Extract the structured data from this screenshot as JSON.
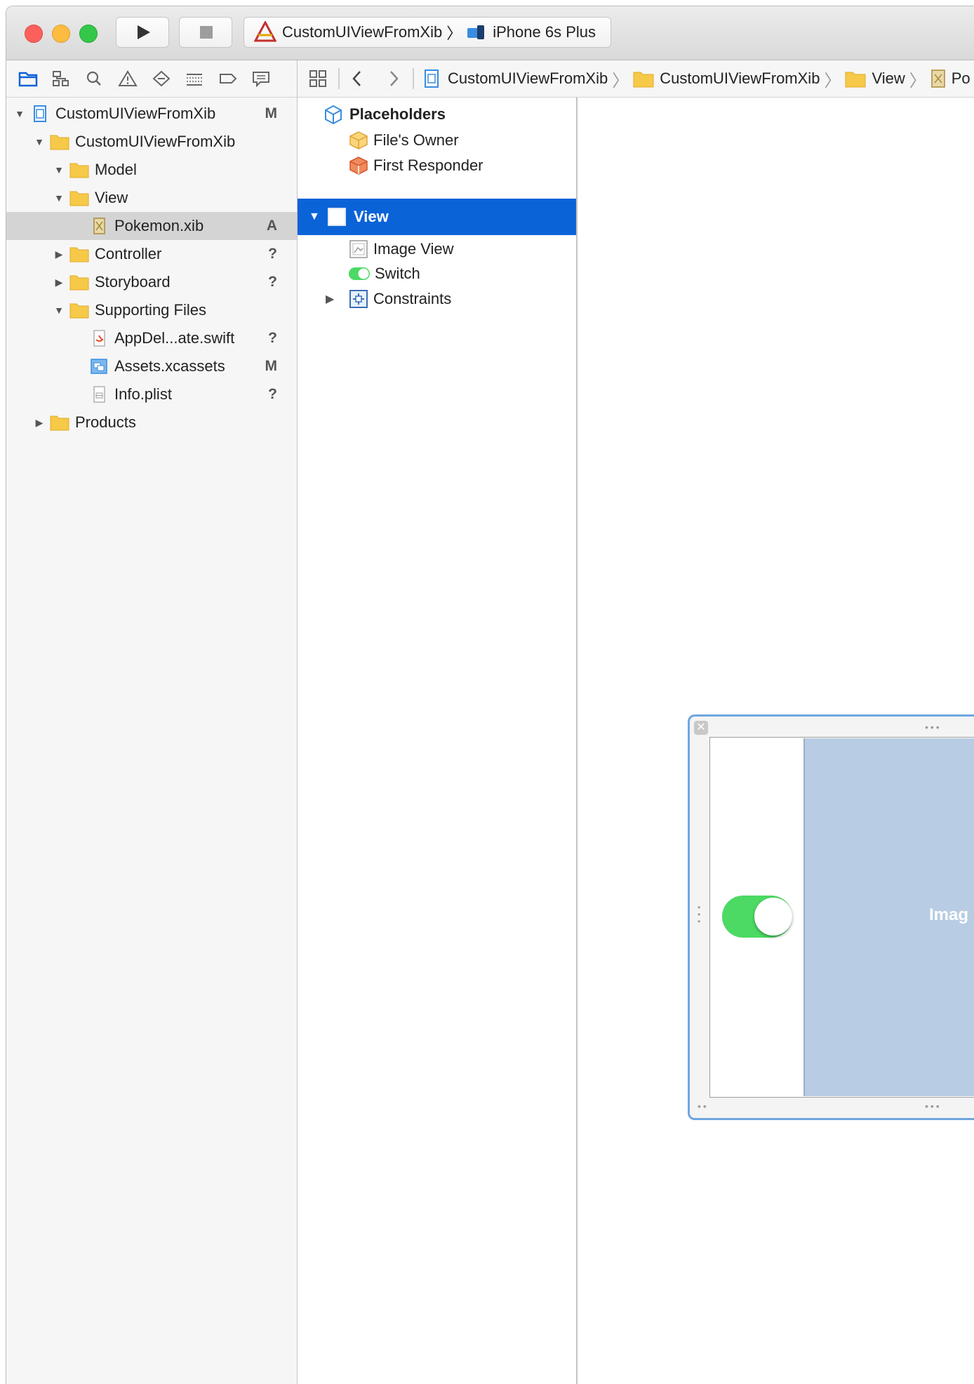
{
  "toolbar": {
    "scheme_project": "CustomUIViewFromXib",
    "scheme_device": "iPhone 6s Plus"
  },
  "jumpbar": {
    "items": [
      "CustomUIViewFromXib",
      "CustomUIViewFromXib",
      "View",
      "Po"
    ]
  },
  "navigator": {
    "items": [
      {
        "label": "CustomUIViewFromXib",
        "status": "M"
      },
      {
        "label": "CustomUIViewFromXib",
        "status": ""
      },
      {
        "label": "Model",
        "status": ""
      },
      {
        "label": "View",
        "status": ""
      },
      {
        "label": "Pokemon.xib",
        "status": "A"
      },
      {
        "label": "Controller",
        "status": "?"
      },
      {
        "label": "Storyboard",
        "status": "?"
      },
      {
        "label": "Supporting Files",
        "status": ""
      },
      {
        "label": "AppDel...ate.swift",
        "status": "?"
      },
      {
        "label": "Assets.xcassets",
        "status": "M"
      },
      {
        "label": "Info.plist",
        "status": "?"
      },
      {
        "label": "Products",
        "status": ""
      }
    ]
  },
  "outline": {
    "placeholders": "Placeholders",
    "files_owner": "File's Owner",
    "first_responder": "First Responder",
    "view": "View",
    "image_view": "Image View",
    "switch": "Switch",
    "constraints": "Constraints"
  },
  "canvas": {
    "image_label": "Imag",
    "switch_on": true
  },
  "colors": {
    "selection": "#0b63d8",
    "switch_on": "#4cd964",
    "imageview_fill": "#b8cce3",
    "folder": "#f7c948"
  }
}
